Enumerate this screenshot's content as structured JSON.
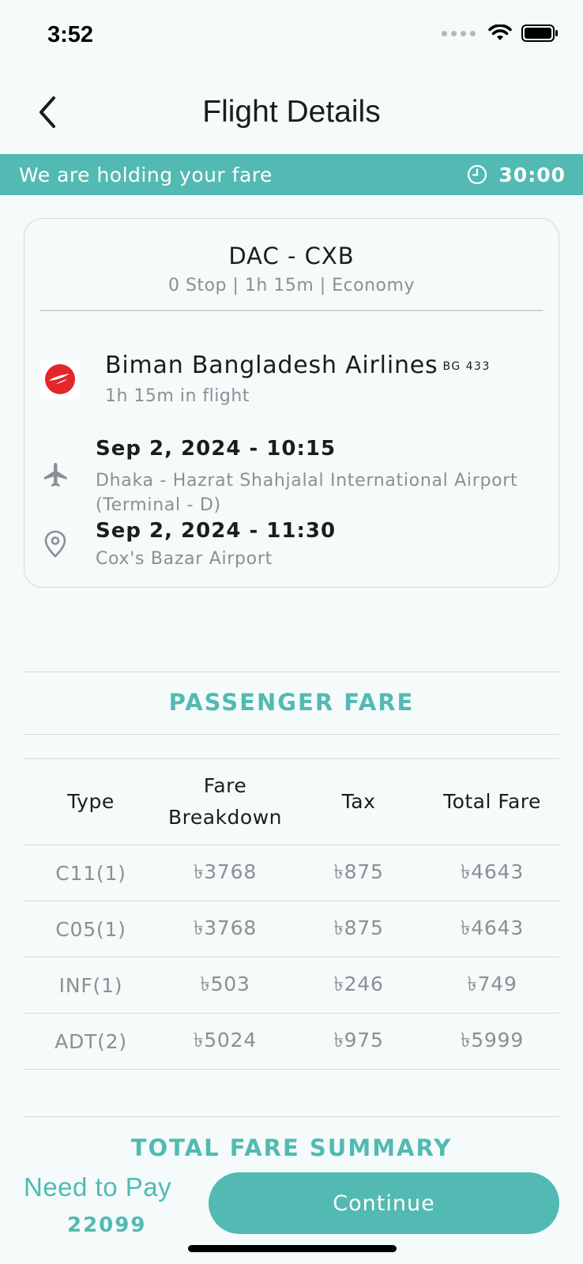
{
  "status_bar": {
    "time": "3:52"
  },
  "nav": {
    "title": "Flight Details"
  },
  "hold_banner": {
    "text": "We are holding your fare",
    "timer": "30:00"
  },
  "flight": {
    "route": "DAC - CXB",
    "meta": "0 Stop | 1h 15m | Economy",
    "airline": "Biman Bangladesh Airlines",
    "flight_no": "BG 433",
    "duration": "1h 15m in flight",
    "departure": {
      "datetime": "Sep 2, 2024 - 10:15",
      "airport": "Dhaka - Hazrat Shahjalal International Airport (Terminal - D)"
    },
    "arrival": {
      "datetime": "Sep 2, 2024 - 11:30",
      "airport": "Cox's Bazar Airport"
    }
  },
  "passenger_fare": {
    "title": "PASSENGER FARE",
    "headers": [
      "Type",
      "Fare Breakdown",
      "Tax",
      "Total Fare"
    ],
    "rows": [
      [
        "C11(1)",
        "৳3768",
        "৳875",
        "৳4643"
      ],
      [
        "C05(1)",
        "৳3768",
        "৳875",
        "৳4643"
      ],
      [
        "INF(1)",
        "৳503",
        "৳246",
        "৳749"
      ],
      [
        "ADT(2)",
        "৳5024",
        "৳975",
        "৳5999"
      ]
    ]
  },
  "summary": {
    "title": "TOTAL FARE SUMMARY"
  },
  "bottom": {
    "need_to_pay_label": "Need to Pay",
    "amount": "22099",
    "continue_label": "Continue"
  },
  "colors": {
    "accent": "#52bab2",
    "background": "#f4fbfa",
    "airline_red": "#e3262b"
  }
}
